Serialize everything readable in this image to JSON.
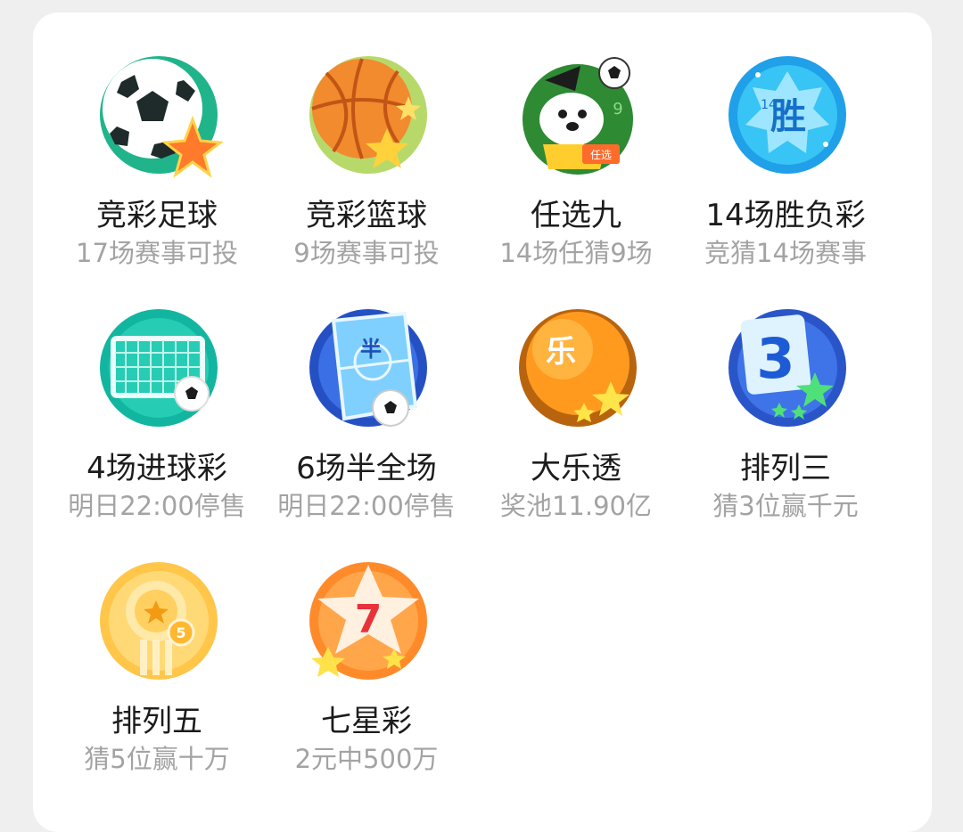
{
  "lotteries": [
    {
      "name": "竞彩足球",
      "sub": "17场赛事可投",
      "icon": "soccer-ball-star-icon"
    },
    {
      "name": "竞彩篮球",
      "sub": "9场赛事可投",
      "icon": "basketball-star-icon"
    },
    {
      "name": "任选九",
      "sub": "14场任猜9场",
      "icon": "mascot-soccer-icon",
      "badge": "任选",
      "digit": "9"
    },
    {
      "name": "14场胜负彩",
      "sub": "竞猜14场赛事",
      "icon": "win-badge-icon",
      "badge": "胜",
      "digit": "14"
    },
    {
      "name": "4场进球彩",
      "sub": "明日22:00停售",
      "icon": "goal-net-icon"
    },
    {
      "name": "6场半全场",
      "sub": "明日22:00停售",
      "icon": "half-field-icon",
      "badge": "半"
    },
    {
      "name": "大乐透",
      "sub": "奖池11.90亿",
      "icon": "lotto-ball-icon",
      "badge": "乐"
    },
    {
      "name": "排列三",
      "sub": "猜3位赢千元",
      "icon": "number-three-icon",
      "badge": "3"
    },
    {
      "name": "排列五",
      "sub": "猜5位赢十万",
      "icon": "number-five-icon",
      "badge": "5"
    },
    {
      "name": "七星彩",
      "sub": "2元中500万",
      "icon": "seven-star-icon",
      "badge": "7"
    }
  ]
}
